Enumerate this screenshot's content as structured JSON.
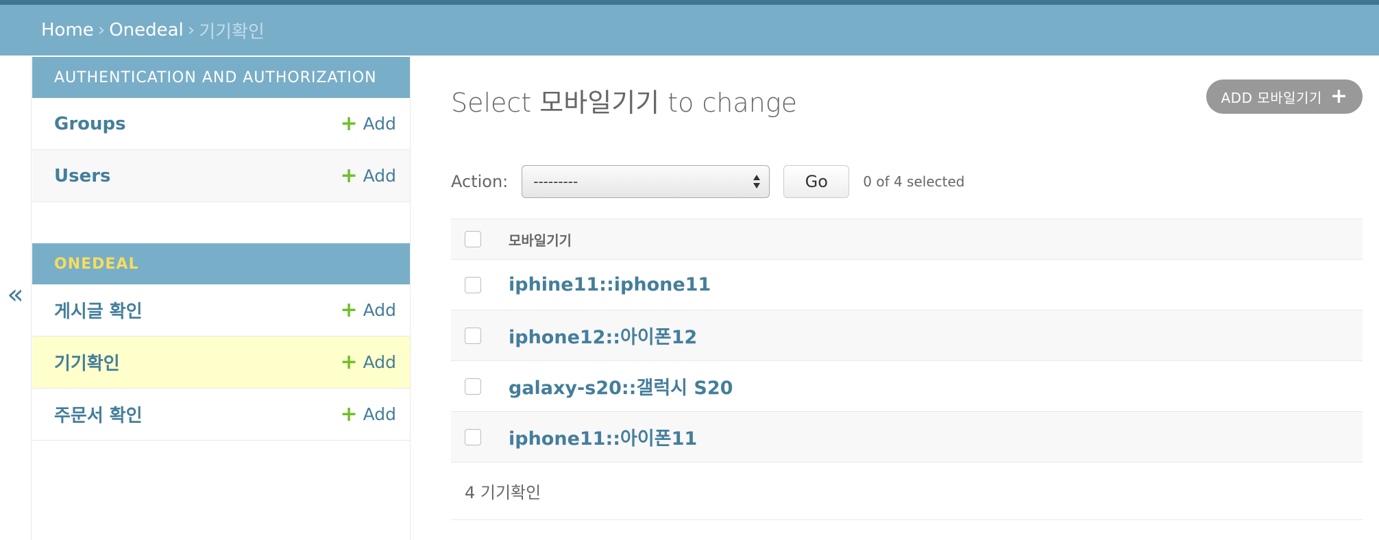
{
  "breadcrumbs": {
    "home": "Home",
    "app": "Onedeal",
    "current": "기기확인",
    "separator": "›"
  },
  "nav_toggle": "«",
  "sidebar": {
    "modules": [
      {
        "caption": "AUTHENTICATION AND AUTHORIZATION",
        "models": [
          {
            "name": "Groups",
            "add": "Add"
          },
          {
            "name": "Users",
            "add": "Add"
          }
        ]
      },
      {
        "caption": "ONEDEAL",
        "models": [
          {
            "name": "게시글 확인",
            "add": "Add"
          },
          {
            "name": "기기확인",
            "add": "Add"
          },
          {
            "name": "주문서 확인",
            "add": "Add"
          }
        ]
      }
    ],
    "plus_glyph": "+"
  },
  "content": {
    "title": "Select 모바일기기 to change",
    "add_button": "ADD 모바일기기",
    "add_button_icon": "+",
    "action_label": "Action:",
    "action_select_value": "---------",
    "go_button": "Go",
    "selected_count": "0 of 4 selected",
    "column_header": "모바일기기",
    "rows": [
      "iphine11::iphone11",
      "iphone12::아이폰12",
      "galaxy-s20::갤럭시 S20",
      "iphone11::아이폰11"
    ],
    "paginator": "4 기기확인"
  },
  "colors": {
    "header_bar": "#79aec8",
    "top_line": "#417690",
    "link": "#447e9b",
    "add_plus": "#70bf2b",
    "current_row": "#ffffcc",
    "onedeal_caption": "#f5dd5d",
    "add_button_bg": "#999999"
  }
}
